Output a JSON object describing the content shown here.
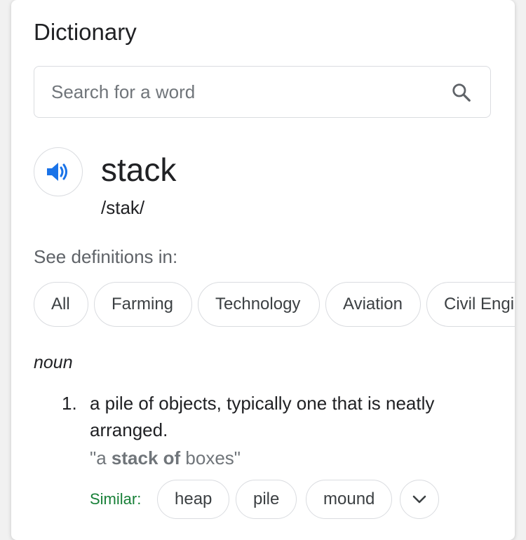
{
  "header": {
    "title": "Dictionary"
  },
  "search": {
    "placeholder": "Search for a word",
    "icon": "search-icon"
  },
  "entry": {
    "word": "stack",
    "phonetic": "/stak/",
    "audio_icon": "speaker-icon"
  },
  "domains": {
    "label": "See definitions in:",
    "chips": [
      "All",
      "Farming",
      "Technology",
      "Aviation",
      "Civil Engi"
    ]
  },
  "definition": {
    "part_of_speech": "noun",
    "number": "1.",
    "text": "a pile of objects, typically one that is neatly arranged.",
    "example_open": "\"a ",
    "example_bold": "stack of",
    "example_close": " boxes\"",
    "similar_label": "Similar:",
    "similar": [
      "heap",
      "pile",
      "mound"
    ],
    "expand_icon": "chevron-down-icon"
  },
  "colors": {
    "accent_blue": "#1a73e8",
    "similar_green": "#188038",
    "border": "#dadce0",
    "muted_text": "#70757a"
  }
}
